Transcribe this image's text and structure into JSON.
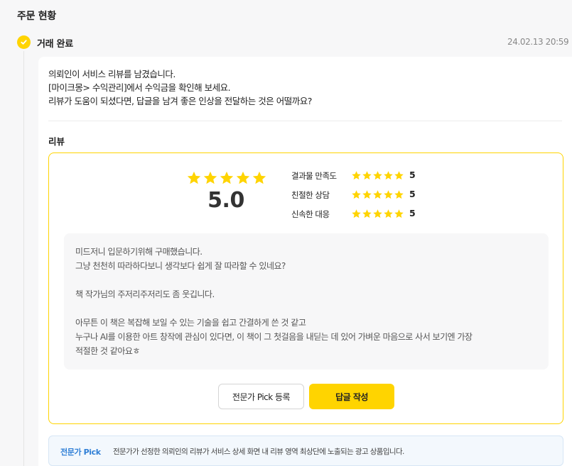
{
  "section": {
    "title": "주문 현황"
  },
  "status": {
    "icon": "check-circle-icon",
    "label": "거래 완료",
    "timestamp": "24.02.13 20:59"
  },
  "message": {
    "lines": [
      "의뢰인이 서비스 리뷰를 남겼습니다.",
      "[마이크몽> 수익관리]에서 수익금을 확인해 보세요.",
      "리뷰가 도움이 되셨다면, 답글을 남겨 좋은 인상을 전달하는 것은 어떨까요?"
    ]
  },
  "review": {
    "heading": "리뷰",
    "overall": {
      "score_text": "5.0",
      "rating": 5,
      "max": 5
    },
    "criteria": [
      {
        "label": "결과물 만족도",
        "rating": 5,
        "score_text": "5"
      },
      {
        "label": "친절한 상담",
        "rating": 5,
        "score_text": "5"
      },
      {
        "label": "신속한 대응",
        "rating": 5,
        "score_text": "5"
      }
    ],
    "text_lines": [
      "미드저니 입문하기위해 구매했습니다.",
      "그냥 천천히 따라하다보니 생각보다 쉽게 잘 따라할 수 있네요?",
      "",
      "책 작가님의 주저리주저리도 좀 웃깁니다.",
      "",
      "아무튼 이 책은 복잡해 보일 수 있는 기술을 쉽고 간결하게 쓴 것 같고",
      "누구나 AI를 이용한 아트 창작에 관심이 있다면, 이 책이 그 첫걸음을 내딛는 데 있어 가벼운 마음으로 사서 보기엔 가장",
      "적절한 것 같아요ㅎ"
    ],
    "buttons": {
      "pick_label": "전문가 Pick 등록",
      "reply_label": "답글 작성"
    }
  },
  "notice": {
    "title": "전문가 Pick",
    "text": "전문가가 선정한 의뢰인의 리뷰가 서비스 상세 화면 내 리뷰 영역 최상단에 노출되는 광고 상품입니다."
  },
  "colors": {
    "accent": "#ffd400",
    "star": "#ffd400",
    "notice_title": "#2f7fd6",
    "notice_bg": "#f3f8fd"
  }
}
